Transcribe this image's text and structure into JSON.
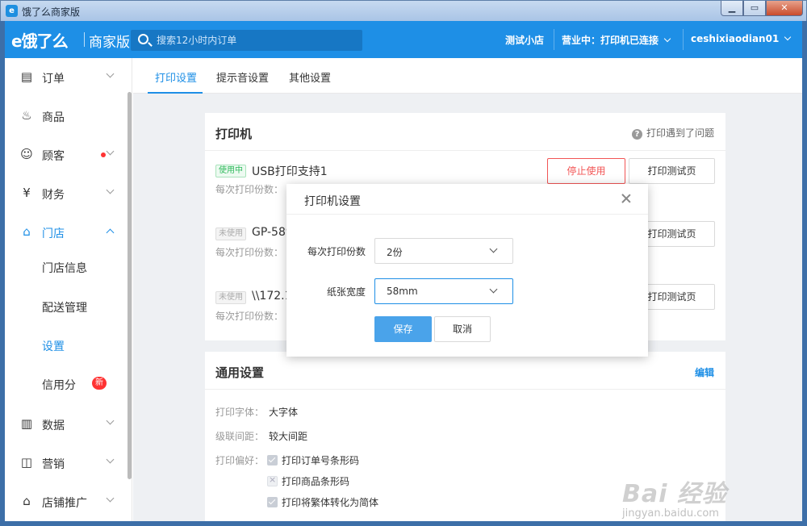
{
  "window": {
    "title": "饿了么商家版",
    "app_icon": "e"
  },
  "topbar": {
    "logo": "e饿了么",
    "logo_sub": "商家版",
    "search_placeholder": "搜索12小时内订单",
    "shop_name": "测试小店",
    "status": "营业中：打印机已连接",
    "user": "ceshixiaodian01"
  },
  "sidebar": {
    "items": [
      {
        "label": "订单",
        "icon": "order-icon",
        "glyph": "▤"
      },
      {
        "label": "商品",
        "icon": "goods-icon",
        "glyph": "♨"
      },
      {
        "label": "顾客",
        "icon": "customer-icon",
        "glyph": "☺"
      },
      {
        "label": "财务",
        "icon": "finance-icon",
        "glyph": "¥"
      },
      {
        "label": "门店",
        "icon": "store-icon",
        "glyph": "⌂"
      },
      {
        "label": "数据",
        "icon": "data-icon",
        "glyph": "▥"
      },
      {
        "label": "营销",
        "icon": "marketing-icon",
        "glyph": "◫"
      },
      {
        "label": "店铺推广",
        "icon": "promotion-icon",
        "glyph": "⌂"
      }
    ],
    "store_sub": [
      "门店信息",
      "配送管理",
      "设置",
      "信用分"
    ],
    "new_badge": "新"
  },
  "tabs": [
    "打印设置",
    "提示音设置",
    "其他设置"
  ],
  "printer_card": {
    "title": "打印机",
    "help": "打印遇到了问题",
    "printers": [
      {
        "badge": "使用中",
        "name": "USB打印支持1",
        "copies_label": "每次打印份数：",
        "stop_btn": "停止使用",
        "test_btn": "打印测试页"
      },
      {
        "badge": "未使用",
        "name": "GP-589",
        "copies_label": "每次打印份数：",
        "test_btn": "打印测试页"
      },
      {
        "badge": "未使用",
        "name": "\\\\172.16",
        "copies_label": "每次打印份数：",
        "test_btn": "打印测试页"
      }
    ]
  },
  "general_card": {
    "title": "通用设置",
    "edit": "编辑",
    "font_label": "打印字体：",
    "font_value": "大字体",
    "spacing_label": "级联间距：",
    "spacing_value": "较大间距",
    "pref_label": "打印偏好：",
    "prefs": [
      "打印订单号条形码",
      "打印商品条形码",
      "打印将繁体转化为简体"
    ]
  },
  "modal": {
    "title": "打印机设置",
    "copies_label": "每次打印份数",
    "copies_value": "2份",
    "width_label": "纸张宽度",
    "width_value": "58mm",
    "save": "保存",
    "cancel": "取消"
  },
  "watermark": {
    "main": "Bai 经验",
    "sub": "jingyan.baidu.com"
  },
  "colors": {
    "brand": "#1e8fe6",
    "danger": "#f25555",
    "badge_on": "#2db95a"
  }
}
